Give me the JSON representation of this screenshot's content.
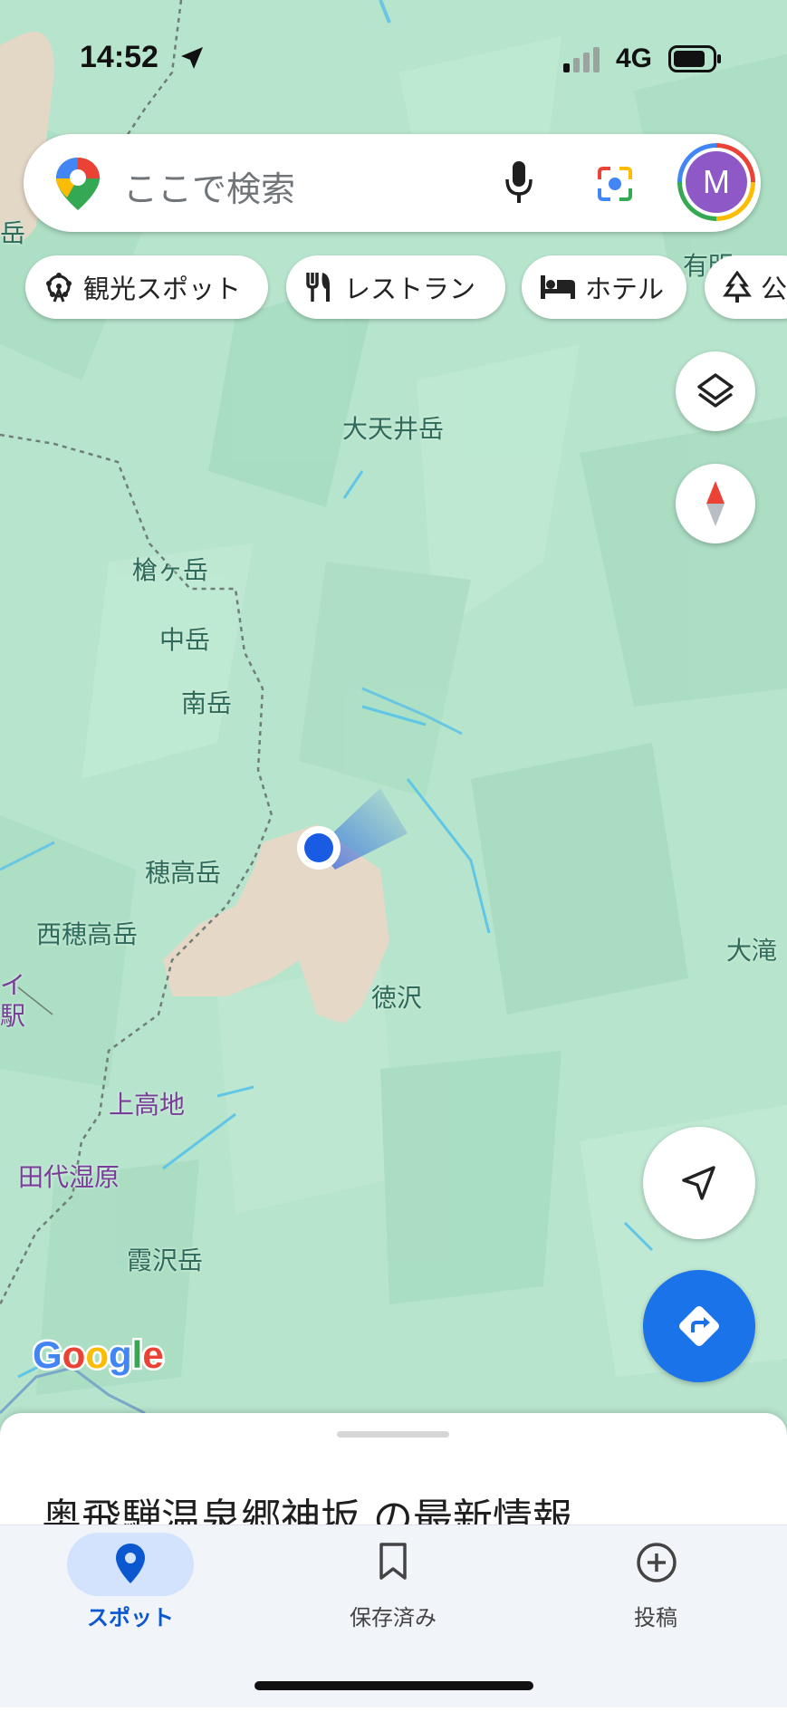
{
  "status_bar": {
    "time": "14:52",
    "network": "4G"
  },
  "search": {
    "placeholder": "ここで検索",
    "avatar_letter": "M"
  },
  "chips": [
    {
      "label": "観光スポット",
      "icon": "ferris-wheel-icon"
    },
    {
      "label": "レストラン",
      "icon": "restaurant-icon"
    },
    {
      "label": "ホテル",
      "icon": "hotel-icon"
    },
    {
      "label": "公",
      "icon": "park-icon"
    }
  ],
  "map": {
    "labels": [
      {
        "text": "有明",
        "style": "normal"
      },
      {
        "text": "大天井岳",
        "style": "normal"
      },
      {
        "text": "槍ヶ岳",
        "style": "normal"
      },
      {
        "text": "中岳",
        "style": "normal"
      },
      {
        "text": "南岳",
        "style": "normal"
      },
      {
        "text": "穂高岳",
        "style": "normal"
      },
      {
        "text": "西穂高岳",
        "style": "normal"
      },
      {
        "text": "徳沢",
        "style": "normal"
      },
      {
        "text": "大滝",
        "style": "normal"
      },
      {
        "text": "上高地",
        "style": "purple"
      },
      {
        "text": "田代湿原",
        "style": "purple"
      },
      {
        "text": "霞沢岳",
        "style": "normal"
      },
      {
        "text": "イ",
        "style": "purple"
      },
      {
        "text": "駅",
        "style": "purple"
      },
      {
        "text": "岳",
        "style": "normal"
      }
    ],
    "attribution": "Google"
  },
  "sheet": {
    "title": "奥飛騨温泉郷神坂 の最新情報"
  },
  "nav": [
    {
      "label": "スポット",
      "icon": "place-pin-icon",
      "active": true
    },
    {
      "label": "保存済み",
      "icon": "bookmark-icon",
      "active": false
    },
    {
      "label": "投稿",
      "icon": "add-circle-icon",
      "active": false
    }
  ],
  "colors": {
    "accent": "#1a73e8",
    "map_bg": "#b9e6cf",
    "location_dot": "#1a5be3"
  }
}
